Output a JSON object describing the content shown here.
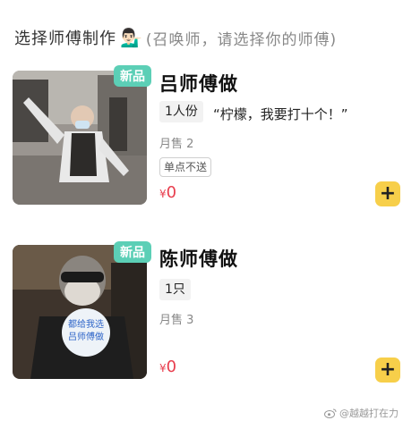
{
  "header": {
    "title": "选择师傅制作",
    "emoji": "💁🏻‍♂️",
    "subtitle": "(召唤师，请选择你的师傅)"
  },
  "items": [
    {
      "badge": "新品",
      "name": "吕师傅做",
      "portion": "1人份",
      "quote": "“柠檬，我要打十个！”",
      "sold": "月售 2",
      "note": "单点不送",
      "currency": "¥",
      "price": "0",
      "add_label": "+"
    },
    {
      "badge": "新品",
      "name": "陈师傅做",
      "portion": "1只",
      "sold": "月售 3",
      "currency": "¥",
      "price": "0",
      "add_label": "+"
    }
  ],
  "photo2_sign": {
    "line1": "都给我选",
    "line2": "吕师傅做"
  },
  "watermark": "@越越打在力"
}
